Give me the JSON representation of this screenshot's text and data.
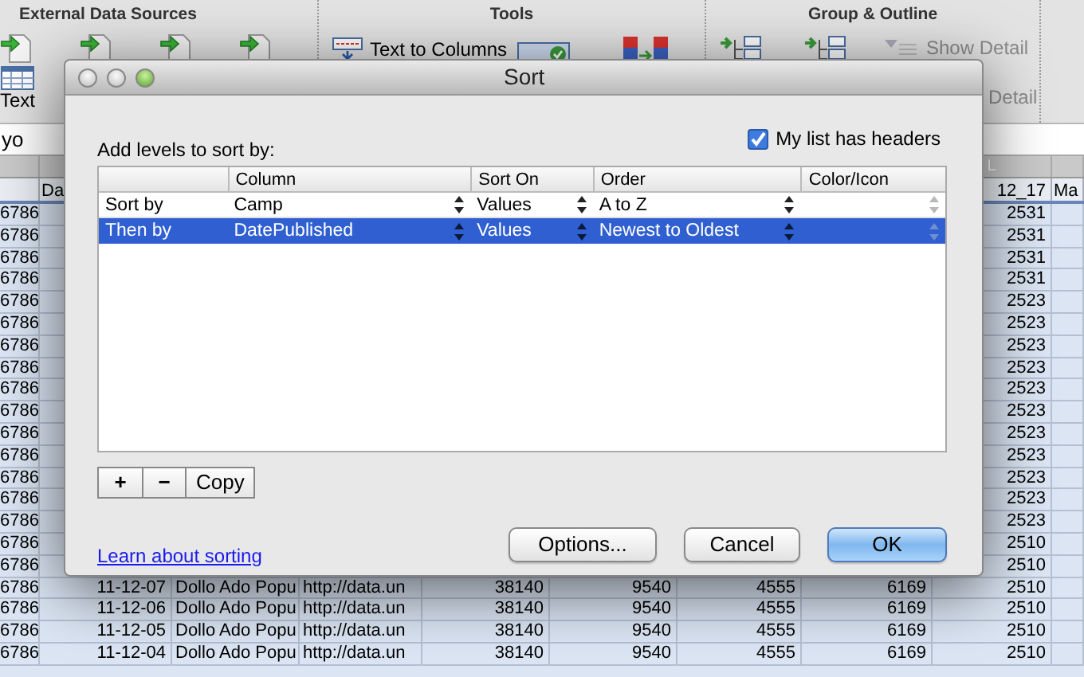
{
  "ribbon": {
    "groups": [
      {
        "title": "External Data Sources",
        "items": [
          {
            "label": "Text"
          }
        ]
      },
      {
        "title": "Tools",
        "items": [
          {
            "label": "Text to Columns"
          }
        ]
      },
      {
        "title": "Group & Outline",
        "items": [
          {
            "label": "Show Detail",
            "disabled": true
          },
          {
            "label": "Detail",
            "disabled": true
          }
        ]
      }
    ]
  },
  "formula_bar": {
    "value": "yo"
  },
  "sheet": {
    "column_letter": "L",
    "header_cells": [
      "Da",
      "12_17",
      "Ma"
    ],
    "rows": [
      {
        "kind": "covered",
        "cells": [
          "6786",
          "2531"
        ]
      },
      {
        "kind": "covered",
        "cells": [
          "6786",
          "2531"
        ]
      },
      {
        "kind": "covered",
        "cells": [
          "6786",
          "2531"
        ]
      },
      {
        "kind": "covered",
        "cells": [
          "6786",
          "2531"
        ]
      },
      {
        "kind": "covered",
        "cells": [
          "6786",
          "2523"
        ]
      },
      {
        "kind": "covered",
        "cells": [
          "6786",
          "2523"
        ]
      },
      {
        "kind": "covered",
        "cells": [
          "6786",
          "2523"
        ]
      },
      {
        "kind": "covered",
        "cells": [
          "6786",
          "2523"
        ]
      },
      {
        "kind": "covered",
        "cells": [
          "6786",
          "2523"
        ]
      },
      {
        "kind": "covered",
        "cells": [
          "6786",
          "2523"
        ]
      },
      {
        "kind": "covered",
        "cells": [
          "6786",
          "2523"
        ]
      },
      {
        "kind": "covered",
        "cells": [
          "6786",
          "2523"
        ]
      },
      {
        "kind": "covered",
        "cells": [
          "6786",
          "2523"
        ]
      },
      {
        "kind": "covered",
        "cells": [
          "6786",
          "2523"
        ]
      },
      {
        "kind": "covered",
        "cells": [
          "6786",
          "2523"
        ]
      },
      {
        "kind": "covered",
        "cells": [
          "6786",
          "2510"
        ]
      },
      {
        "kind": "covered",
        "cells": [
          "6786",
          "2510"
        ]
      },
      {
        "kind": "full",
        "cells": [
          "6786",
          "11-12-07",
          "Dollo Ado Popu",
          "http://data.un",
          "38140",
          "9540",
          "4555",
          "6169",
          "2510"
        ]
      },
      {
        "kind": "full",
        "cells": [
          "6786",
          "11-12-06",
          "Dollo Ado Popu",
          "http://data.un",
          "38140",
          "9540",
          "4555",
          "6169",
          "2510"
        ]
      },
      {
        "kind": "full",
        "cells": [
          "6786",
          "11-12-05",
          "Dollo Ado Popu",
          "http://data.un",
          "38140",
          "9540",
          "4555",
          "6169",
          "2510"
        ]
      },
      {
        "kind": "full",
        "cells": [
          "6786",
          "11-12-04",
          "Dollo Ado Popu",
          "http://data.un",
          "38140",
          "9540",
          "4555",
          "6169",
          "2510"
        ]
      }
    ]
  },
  "dialog": {
    "title": "Sort",
    "prompt": "Add levels to sort by:",
    "has_headers": {
      "label": "My list has headers",
      "checked": true
    },
    "columns": [
      "Column",
      "Sort On",
      "Order",
      "Color/Icon"
    ],
    "levels": [
      {
        "label": "Sort by",
        "column": "Camp",
        "sort_on": "Values",
        "order": "A to Z",
        "selected": false
      },
      {
        "label": "Then by",
        "column": "DatePublished",
        "sort_on": "Values",
        "order": "Newest to Oldest",
        "selected": true
      }
    ],
    "level_buttons": [
      "+",
      "−",
      "Copy"
    ],
    "link": "Learn about sorting",
    "buttons": [
      {
        "label": "Options...",
        "kind": "normal"
      },
      {
        "label": "Cancel",
        "kind": "normal"
      },
      {
        "label": "OK",
        "kind": "default"
      }
    ]
  }
}
